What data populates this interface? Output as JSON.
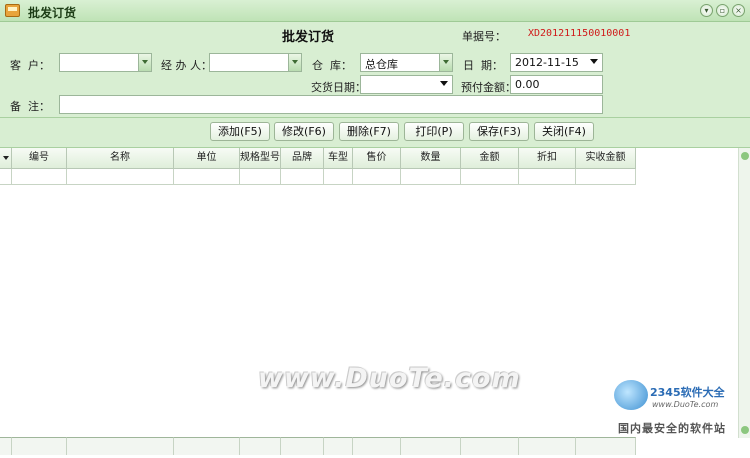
{
  "window": {
    "title": "批发订货"
  },
  "form": {
    "heading": "批发订货",
    "doc_no_label": "单据号：",
    "doc_no_value": "XD201211150010001",
    "customer_label": "客  户：",
    "customer_value": "",
    "handler_label": "经 办 人：",
    "handler_value": "",
    "warehouse_label": "仓  库：",
    "warehouse_value": "总仓库",
    "date_label": "日  期：",
    "date_value": "2012-11-15",
    "delivery_date_label": "交货日期：",
    "delivery_date_value": "",
    "prepaid_label": "预付金额：",
    "prepaid_value": "0.00",
    "note_label": "备  注：",
    "note_value": ""
  },
  "toolbar": {
    "add": "添加(F5)",
    "edit": "修改(F6)",
    "delete": "删除(F7)",
    "print": "打印(P)",
    "save": "保存(F3)",
    "close": "关闭(F4)"
  },
  "grid": {
    "columns": [
      "编号",
      "名称",
      "单位",
      "规格型号",
      "品牌",
      "车型",
      "售价",
      "数量",
      "金额",
      "折扣",
      "实收金额"
    ]
  },
  "watermark": {
    "main": "www.DuoTe.com",
    "brand": "2345软件大全",
    "url": "www.DuoTe.com",
    "tagline": "国内最安全的软件站"
  },
  "colors": {
    "window_bg": "#d8eed2",
    "accent_red": "#d01a1a"
  }
}
